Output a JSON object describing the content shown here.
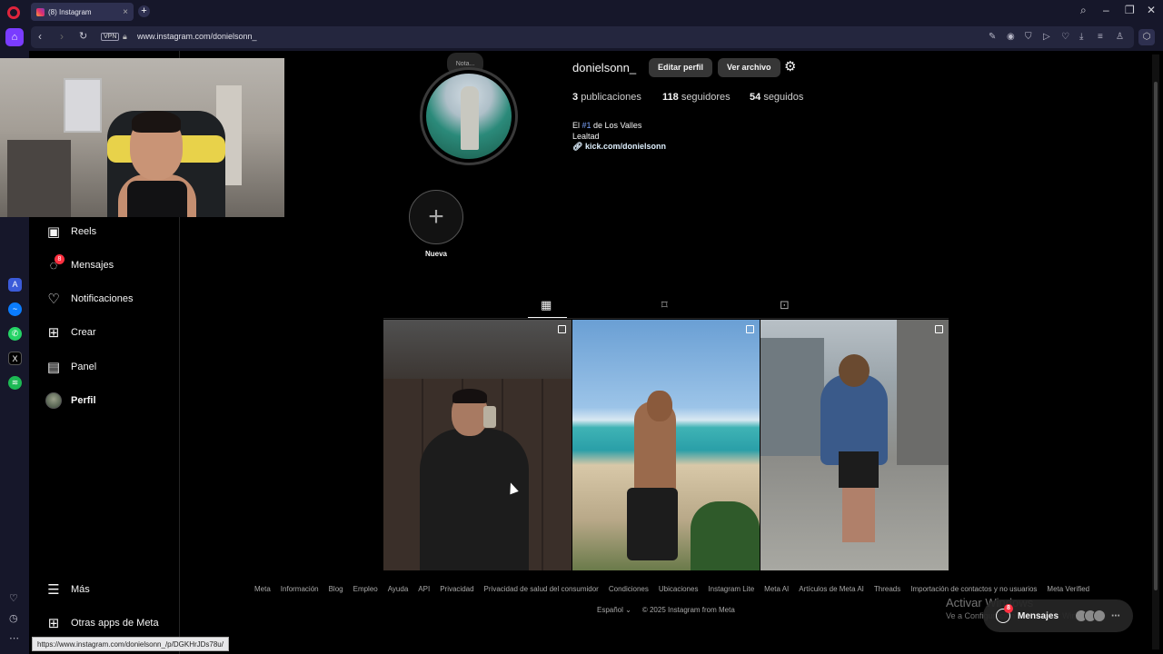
{
  "browser": {
    "tab_title": "(8) Instagram",
    "url": "www.instagram.com/donielsonn_",
    "vpn_label": "VPN",
    "accent": "#7a3cff"
  },
  "nav": {
    "items": [
      {
        "label": "Reels",
        "icon": "reels-icon"
      },
      {
        "label": "Mensajes",
        "icon": "messenger-icon",
        "badge": "8"
      },
      {
        "label": "Notificaciones",
        "icon": "heart-icon"
      },
      {
        "label": "Crear",
        "icon": "plus-square-icon"
      },
      {
        "label": "Panel",
        "icon": "bar-chart-icon"
      },
      {
        "label": "Perfil",
        "icon": "avatar"
      }
    ],
    "more_label": "Más",
    "meta_apps_label": "Otras apps de Meta"
  },
  "profile": {
    "note_label": "Nota...",
    "username": "donielsonn_",
    "edit_button": "Editar perfil",
    "archive_button": "Ver archivo",
    "stats": [
      {
        "count": "3",
        "label": "publicaciones"
      },
      {
        "count": "118",
        "label": "seguidores"
      },
      {
        "count": "54",
        "label": "seguidos"
      }
    ],
    "bio_line1_pre": "El ",
    "bio_line1_tag": "#1",
    "bio_line1_post": " de Los Valles",
    "bio_line2": "Lealtad",
    "bio_link": "kick.com/donielsonn",
    "highlight_label": "Nueva"
  },
  "footer": {
    "links": [
      "Meta",
      "Información",
      "Blog",
      "Empleo",
      "Ayuda",
      "API",
      "Privacidad",
      "Privacidad de salud del consumidor",
      "Condiciones",
      "Ubicaciones",
      "Instagram Lite",
      "Meta AI",
      "Artículos de Meta AI",
      "Threads",
      "Importación de contactos y no usuarios",
      "Meta Verified"
    ],
    "language": "Español",
    "copyright": "© 2025 Instagram from Meta"
  },
  "windows_watermark": {
    "line1": "Activar Windows",
    "line2": "Ve a Configuración para activar Windows."
  },
  "messages_pill": {
    "label": "Mensajes",
    "badge": "8"
  },
  "status_bar_url": "https://www.instagram.com/donielsonn_/p/DGKHrJDs78u/"
}
